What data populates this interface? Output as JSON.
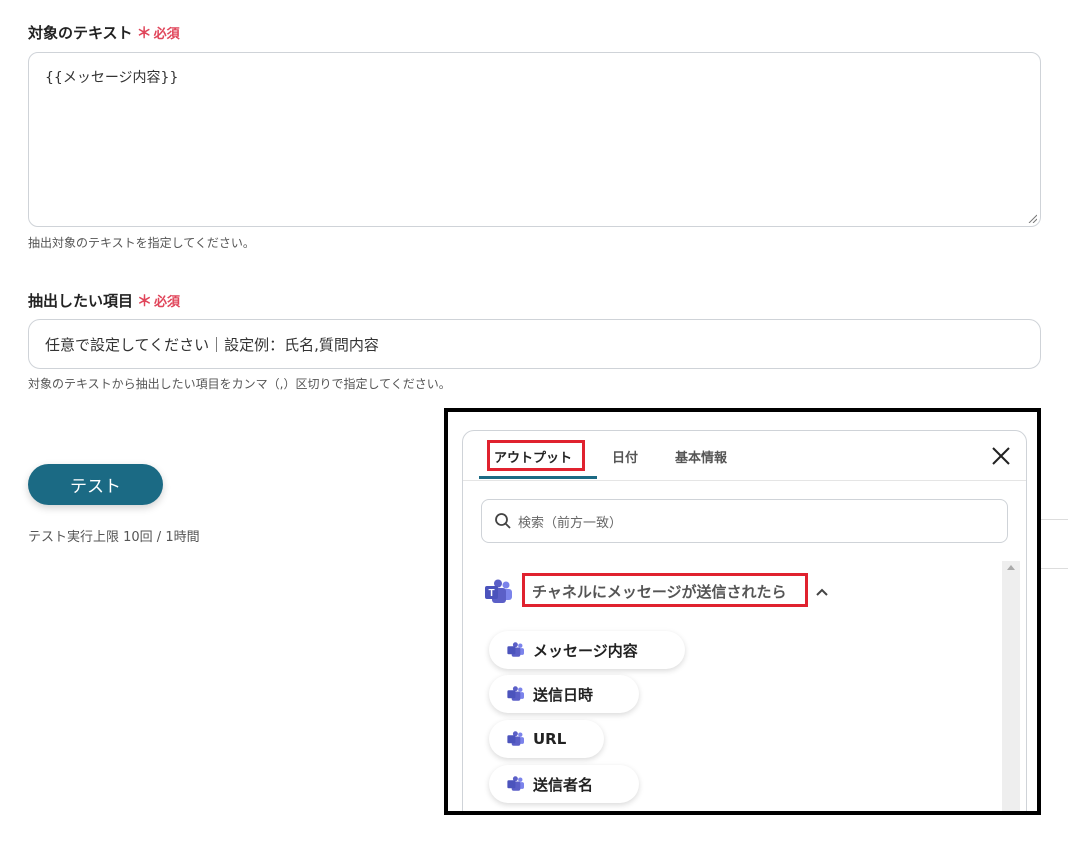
{
  "form": {
    "target_text": {
      "label": "対象のテキスト",
      "required_star": "＊",
      "required_text": "必須",
      "value": "{{メッセージ内容}}",
      "help": "抽出対象のテキストを指定してください。"
    },
    "extract_items": {
      "label": "抽出したい項目",
      "required_star": "＊",
      "required_text": "必須",
      "value": "任意で設定してください｜設定例：氏名,質問内容",
      "help": "対象のテキストから抽出したい項目をカンマ（,）区切りで指定してください。"
    },
    "test_button": "テスト",
    "test_limit": "テスト実行上限 10回 / 1時間"
  },
  "output_panel": {
    "tabs": [
      {
        "label": "アウトプット",
        "active": true
      },
      {
        "label": "日付",
        "active": false
      },
      {
        "label": "基本情報",
        "active": false
      }
    ],
    "search_placeholder": "検索（前方一致）",
    "group_title": "チャネルにメッセージが送信されたら",
    "items": [
      "メッセージ内容",
      "送信日時",
      "URL",
      "送信者名"
    ]
  },
  "colors": {
    "primary": "#1b6a84",
    "required": "#e0455a",
    "highlight": "#e0222f",
    "teams": "#5b5fc7"
  }
}
